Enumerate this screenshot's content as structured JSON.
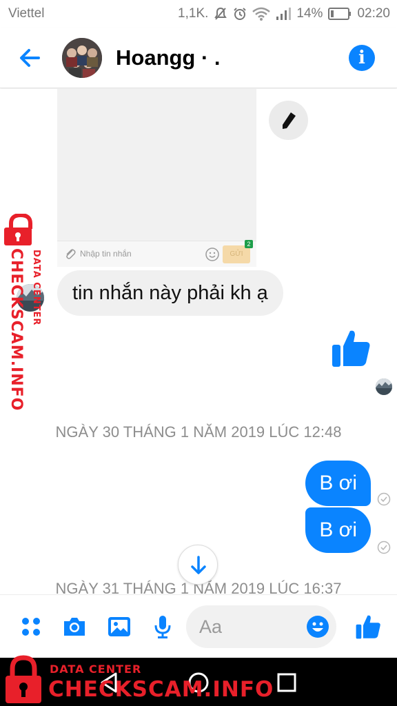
{
  "status_bar": {
    "carrier": "Viettel",
    "notification_count": "1,1K.",
    "battery": "14%",
    "time": "02:20",
    "icons": [
      "mute-icon",
      "alarm-icon",
      "wifi-icon",
      "signal-icon",
      "battery-icon"
    ]
  },
  "header": {
    "contact_name": "Hoangg · .",
    "back_icon": "arrow-left-icon",
    "info_icon": "info-icon",
    "accent_color": "#0a84ff"
  },
  "thread": {
    "shared_image": {
      "input_placeholder": "Nhập tin nhắn",
      "send_label": "GỬI",
      "badge": "2"
    },
    "incoming_message": "tin nhắn này phải kh ạ",
    "timestamps": [
      "NGÀY 30 THÁNG 1 NĂM 2019 LÚC 12:48",
      "NGÀY 31 THÁNG 1 NĂM 2019 LÚC 16:37"
    ],
    "outgoing_messages": [
      "B ơi",
      "B ơi"
    ],
    "bubble_color": "#0a84ff",
    "incoming_bubble_color": "#f0f0f0"
  },
  "composer": {
    "placeholder": "Aa",
    "tools": [
      "apps-icon",
      "camera-icon",
      "image-icon",
      "mic-icon"
    ],
    "like_icon": "thumbs-up-icon",
    "emoji_icon": "smile-icon"
  },
  "navbar": {
    "buttons": [
      "back-triangle-icon",
      "home-circle-icon",
      "recents-square-icon"
    ]
  },
  "watermark": {
    "line_small": "DATA CENTER",
    "line_big": "CHECKSCAM.INFO",
    "color": "#e8202a"
  }
}
